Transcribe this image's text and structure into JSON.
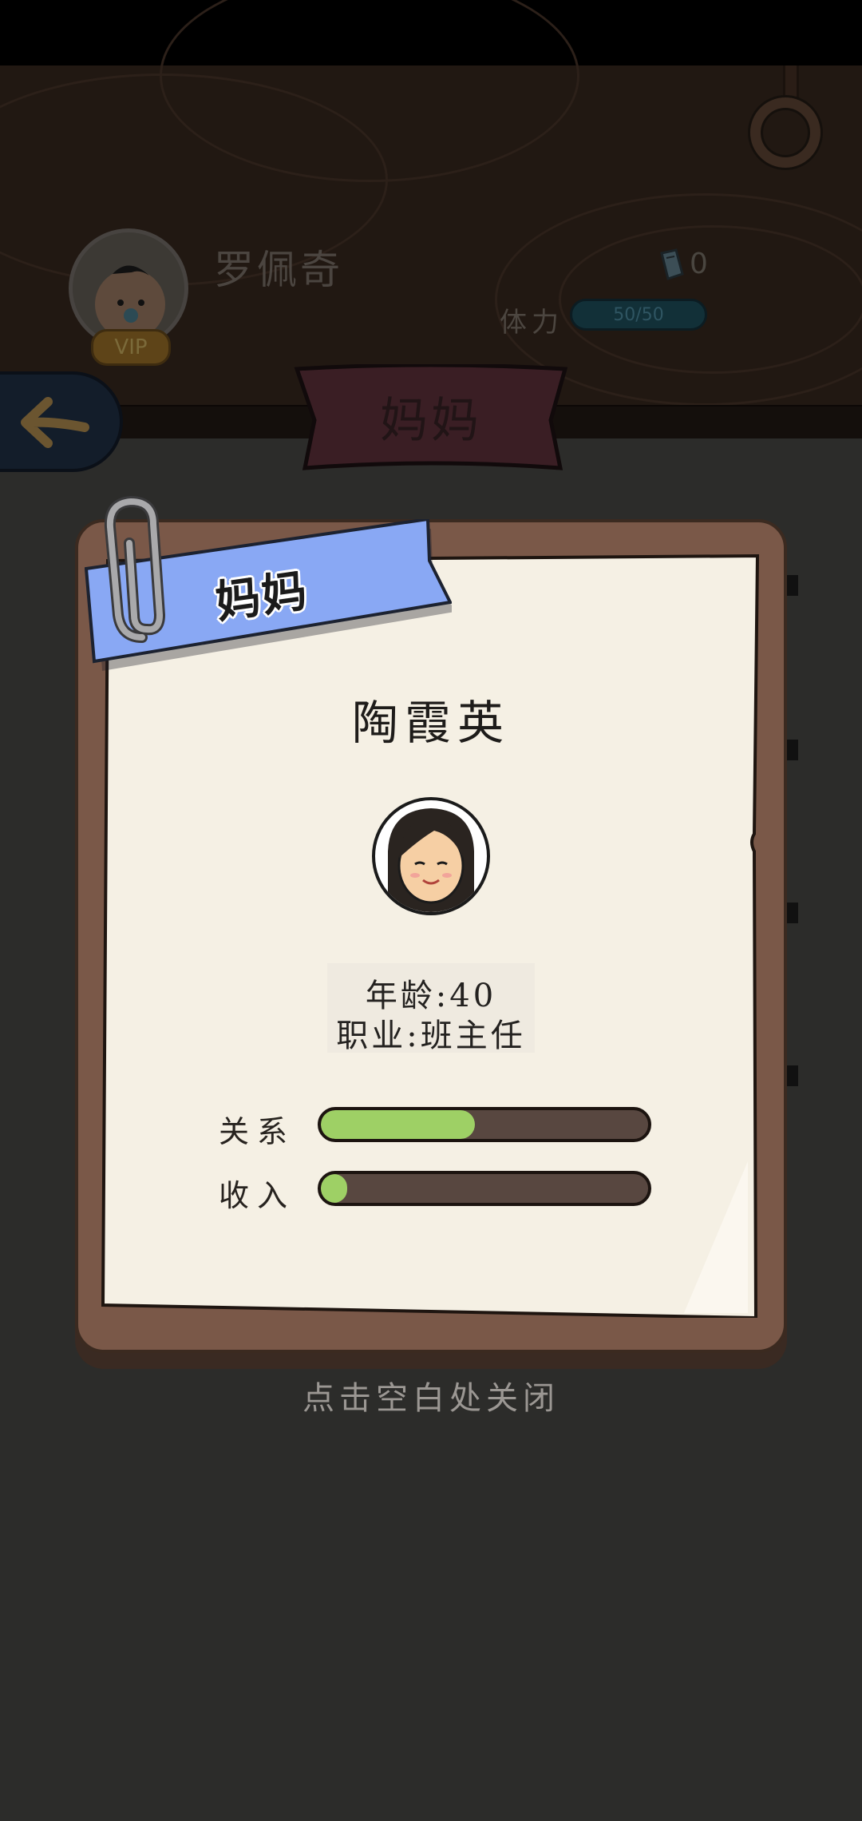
{
  "header": {
    "player_name": "罗佩奇",
    "vip_label": "VIP",
    "coin_count": "0",
    "stamina_label": "体力",
    "stamina_value": "50/50"
  },
  "title_ribbon": "妈妈",
  "card": {
    "tag_label": "妈妈",
    "person_name": "陶霞英",
    "age_line": "年龄:40",
    "job_line": "职业:班主任",
    "stats": [
      {
        "label": "关系",
        "fraction": 0.47
      },
      {
        "label": "收入",
        "fraction": 0.08
      }
    ]
  },
  "close_hint": "点击空白处关闭",
  "colors": {
    "stat_fill": "#9ed065",
    "tag_blue": "#89a8f4",
    "card_frame": "#7a5848",
    "paper": "#f5f0e4"
  },
  "icons": [
    "back-arrow-icon",
    "paperclip-icon",
    "coin-icon",
    "ring-icon"
  ]
}
